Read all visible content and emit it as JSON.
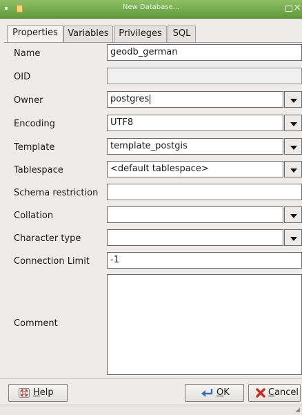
{
  "window": {
    "title": "New Database..."
  },
  "tabs": [
    {
      "label": "Properties",
      "active": true
    },
    {
      "label": "Variables",
      "active": false
    },
    {
      "label": "Privileges",
      "active": false
    },
    {
      "label": "SQL",
      "active": false
    }
  ],
  "form": {
    "name": {
      "label": "Name",
      "value": "geodb_german"
    },
    "oid": {
      "label": "OID",
      "value": ""
    },
    "owner": {
      "label": "Owner",
      "value": "postgres"
    },
    "encoding": {
      "label": "Encoding",
      "value": "UTF8"
    },
    "template": {
      "label": "Template",
      "value": "template_postgis"
    },
    "tablespace": {
      "label": "Tablespace",
      "value": "<default tablespace>"
    },
    "schema": {
      "label": "Schema restriction",
      "value": ""
    },
    "collation": {
      "label": "Collation",
      "value": ""
    },
    "ctype": {
      "label": "Character type",
      "value": ""
    },
    "connlimit": {
      "label": "Connection Limit",
      "value": "-1"
    },
    "comment": {
      "label": "Comment",
      "value": ""
    }
  },
  "buttons": {
    "help": "Help",
    "ok": "OK",
    "cancel": "Cancel"
  },
  "icons": {
    "help": "lifebuoy-icon",
    "ok": "enter-arrow-icon",
    "cancel": "red-x-icon"
  },
  "colors": {
    "titlebar": "#6fa64a",
    "window_bg": "#edeceb"
  }
}
